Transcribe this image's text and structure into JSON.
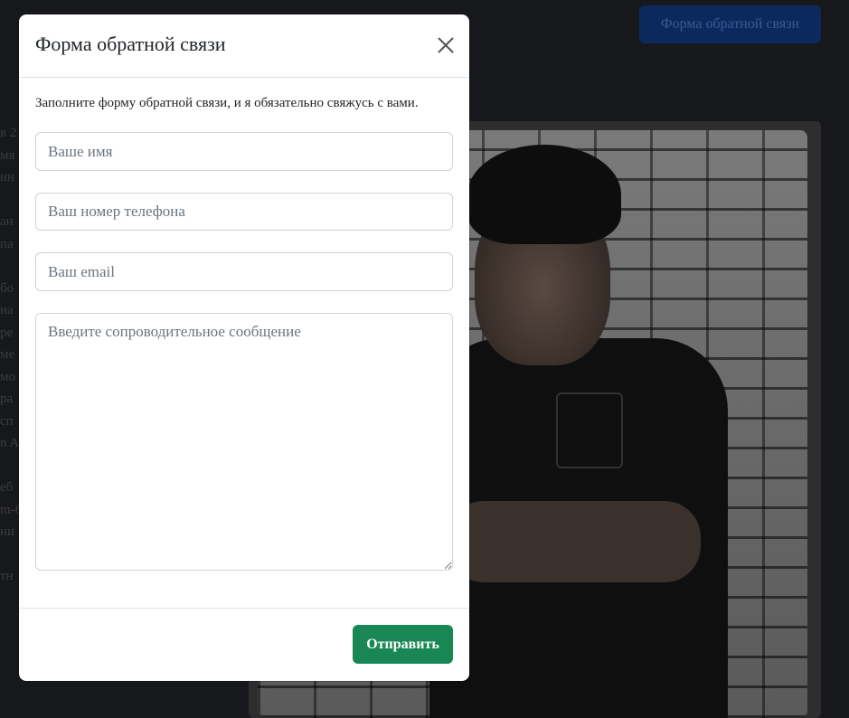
{
  "background": {
    "header_button_label": "Форма обратной связи",
    "side_text_fragments": [
      "в 2",
      "мя",
      "ин",
      "",
      "ан",
      "па",
      "",
      "бо",
      "на",
      "ре",
      "ме",
      "мо",
      "ра",
      "сп",
      "n A",
      "",
      "еб",
      "m-6",
      "ни",
      "",
      "тн"
    ]
  },
  "modal": {
    "title": "Форма обратной связи",
    "intro": "Заполните форму обратной связи, и я обязательно свяжусь с вами.",
    "fields": {
      "name": {
        "placeholder": "Ваше имя",
        "value": ""
      },
      "phone": {
        "placeholder": "Ваш номер телефона",
        "value": ""
      },
      "email": {
        "placeholder": "Ваш email",
        "value": ""
      },
      "message": {
        "placeholder": "Введите сопроводительное сообщение",
        "value": ""
      }
    },
    "submit_label": "Отправить"
  },
  "colors": {
    "submit_button": "#198754",
    "background_button": "#0a2a5e",
    "page_background": "#17181b"
  },
  "icons": {
    "close": "close-icon"
  }
}
